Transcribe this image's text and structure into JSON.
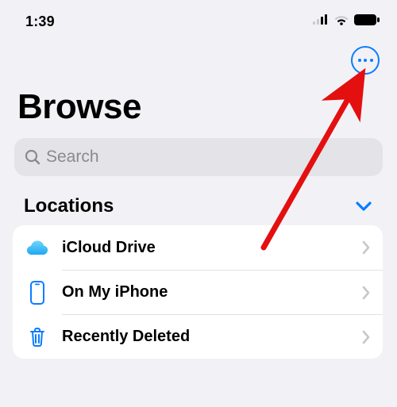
{
  "status_bar": {
    "time": "1:39"
  },
  "nav": {
    "more_button_label": "More"
  },
  "title": "Browse",
  "search": {
    "placeholder": "Search",
    "value": ""
  },
  "locations": {
    "header": "Locations",
    "items": [
      {
        "icon": "cloud",
        "label": "iCloud Drive"
      },
      {
        "icon": "iphone",
        "label": "On My iPhone"
      },
      {
        "icon": "trash",
        "label": "Recently Deleted"
      }
    ]
  },
  "annotation": {
    "arrow_color": "#e40f0f",
    "points_to": "more-button"
  }
}
